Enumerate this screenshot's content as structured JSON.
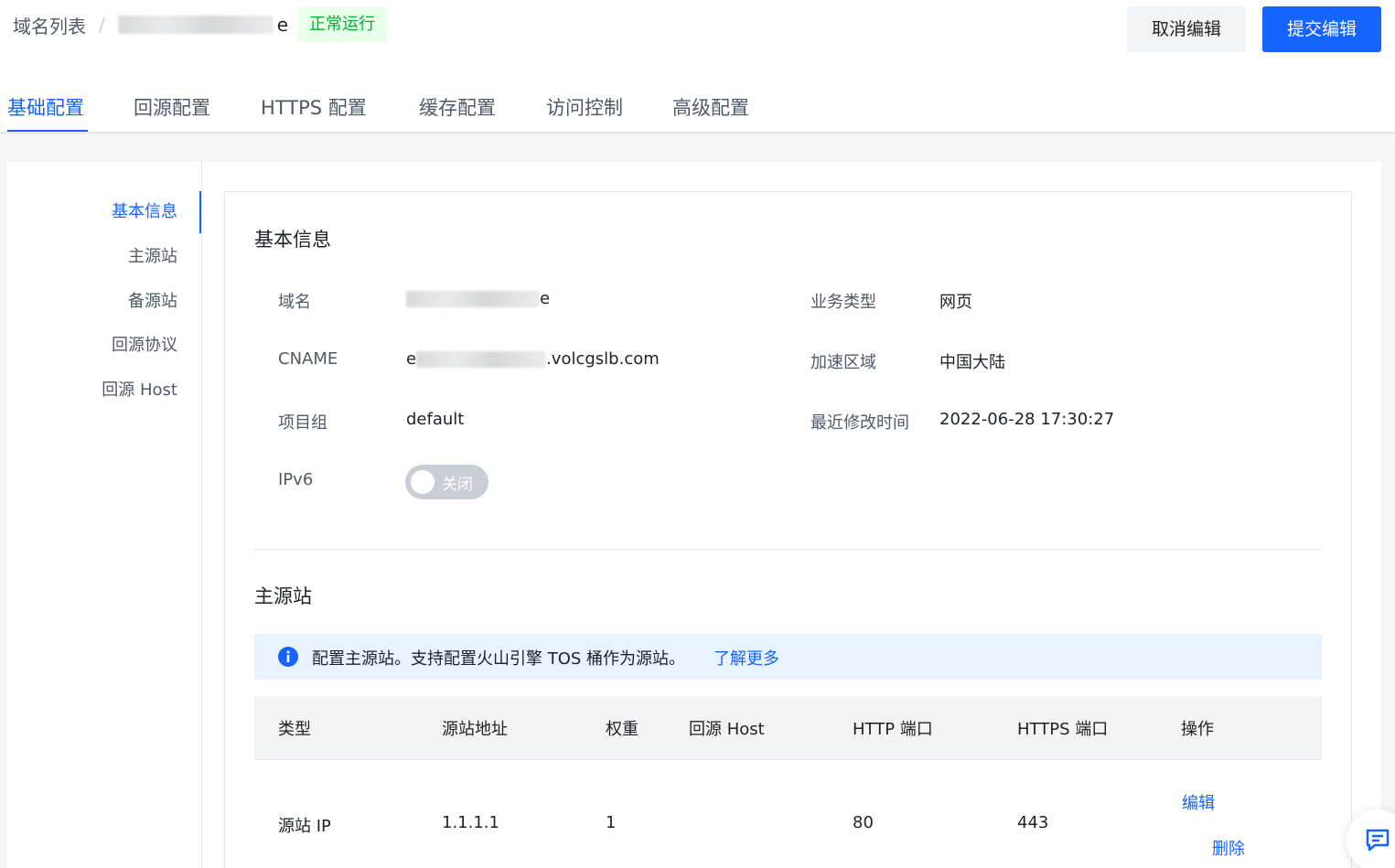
{
  "header": {
    "breadcrumb_root": "域名列表",
    "breadcrumb_separator": "/",
    "domain_suffix": "e",
    "status": "正常运行",
    "cancel_label": "取消编辑",
    "submit_label": "提交编辑"
  },
  "tabs": [
    {
      "label": "基础配置",
      "active": true
    },
    {
      "label": "回源配置",
      "active": false
    },
    {
      "label": "HTTPS 配置",
      "active": false
    },
    {
      "label": "缓存配置",
      "active": false
    },
    {
      "label": "访问控制",
      "active": false
    },
    {
      "label": "高级配置",
      "active": false
    }
  ],
  "anchor_nav": [
    {
      "label": "基本信息",
      "active": true
    },
    {
      "label": "主源站",
      "active": false
    },
    {
      "label": "备源站",
      "active": false
    },
    {
      "label": "回源协议",
      "active": false
    },
    {
      "label": "回源 Host",
      "active": false
    }
  ],
  "basic_info": {
    "title": "基本信息",
    "domain_label": "域名",
    "domain_suffix": "e",
    "cname_label": "CNAME",
    "cname_prefix": "e",
    "cname_suffix": ".volcgslb.com",
    "project_label": "项目组",
    "project_value": "default",
    "ipv6_label": "IPv6",
    "ipv6_toggle_label": "关闭",
    "ipv6_enabled": false,
    "business_type_label": "业务类型",
    "business_type_value": "网页",
    "region_label": "加速区域",
    "region_value": "中国大陆",
    "modified_label": "最近修改时间",
    "modified_value": "2022-06-28 17:30:27"
  },
  "primary_origin": {
    "title": "主源站",
    "alert_text": "配置主源站。支持配置火山引擎 TOS 桶作为源站。",
    "alert_link": "了解更多",
    "columns": [
      "类型",
      "源站地址",
      "权重",
      "回源 Host",
      "HTTP 端口",
      "HTTPS 端口",
      "操作"
    ],
    "rows": [
      {
        "type": "源站 IP",
        "address": "1.1.1.1",
        "weight": "1",
        "host": "",
        "http_port": "80",
        "https_port": "443",
        "edit": "编辑",
        "delete": "删除"
      }
    ]
  },
  "colors": {
    "accent": "#1664ff",
    "success": "#00b42a",
    "success_bg": "#e8ffea",
    "info_bg": "#e8f3ff"
  }
}
